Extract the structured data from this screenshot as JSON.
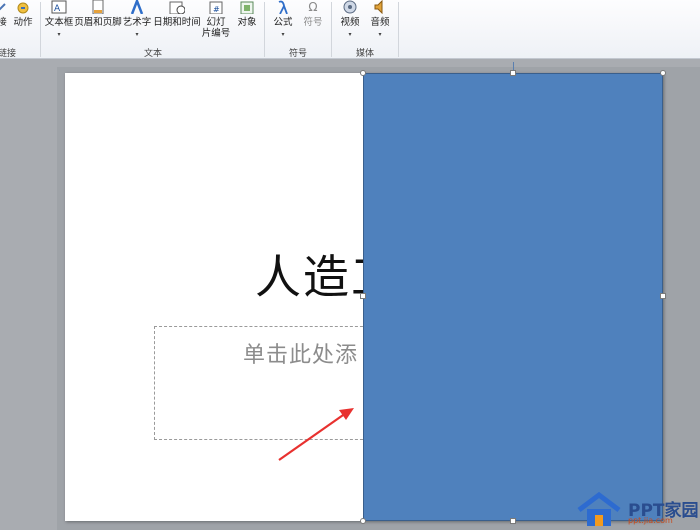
{
  "ribbon": {
    "links_group": {
      "label": "链接",
      "buttons": [
        {
          "label": "接",
          "icon": "hyperlink-icon"
        },
        {
          "label": "动作",
          "icon": "action-icon"
        }
      ]
    },
    "text_group": {
      "label": "文本",
      "buttons": [
        {
          "label": "文本框",
          "icon": "textbox-icon",
          "arrow": "▾"
        },
        {
          "label": "页眉和页脚",
          "icon": "header-footer-icon"
        },
        {
          "label": "艺术字",
          "icon": "wordart-icon",
          "arrow": "▾"
        },
        {
          "label": "日期和时间",
          "icon": "date-time-icon"
        },
        {
          "label_line1": "幻灯",
          "label_line2": "片编号",
          "icon": "slide-number-icon"
        },
        {
          "label": "对象",
          "icon": "object-icon"
        }
      ]
    },
    "symbols_group": {
      "label": "符号",
      "buttons": [
        {
          "label": "公式",
          "icon": "equation-icon",
          "arrow": "▾"
        },
        {
          "label": "符号",
          "icon": "symbol-icon",
          "icon_text": "Ω"
        }
      ]
    },
    "media_group": {
      "label": "媒体",
      "buttons": [
        {
          "label": "视频",
          "icon": "video-icon",
          "arrow": "▾"
        },
        {
          "label": "音频",
          "icon": "audio-icon",
          "arrow": "▾"
        }
      ]
    }
  },
  "slide": {
    "title_visible": "人造工",
    "subtitle_visible": "单击此处添"
  },
  "watermark": {
    "brand": "PPT家园",
    "site": "ppt.jia.com"
  },
  "colors": {
    "shape_fill": "#4f81bd",
    "arrow": "#e8312f",
    "ribbon_bg": "#f3f5f8"
  }
}
